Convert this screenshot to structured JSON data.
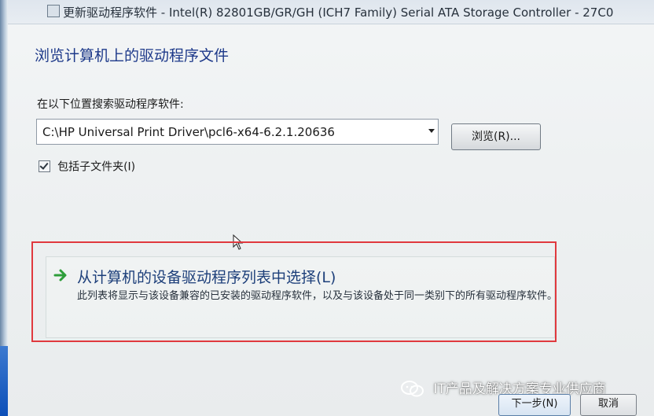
{
  "window": {
    "title": "更新驱动程序软件 - Intel(R) 82801GB/GR/GH (ICH7 Family) Serial ATA Storage Controller - 27C0"
  },
  "page": {
    "heading": "浏览计算机上的驱动程序文件",
    "search_label": "在以下位置搜索驱动程序软件:",
    "path_value": "C:\\HP Universal Print Driver\\pcl6-x64-6.2.1.20636",
    "browse_label": "浏览(R)...",
    "include_subfolders_label": "包括子文件夹(I)",
    "include_subfolders_checked": true
  },
  "option": {
    "title": "从计算机的设备驱动程序列表中选择(L)",
    "description": "此列表将显示与该设备兼容的已安装的驱动程序软件，以及与该设备处于同一类别下的所有驱动程序软件。",
    "arrow_color": "#2e9e3a"
  },
  "footer": {
    "next_label": "下一步(N)",
    "cancel_label": "取消"
  },
  "watermark": {
    "text": "IT产品及解决方案专业供应商"
  },
  "colors": {
    "heading": "#1e3a8a",
    "highlight_border": "#e0393e"
  }
}
